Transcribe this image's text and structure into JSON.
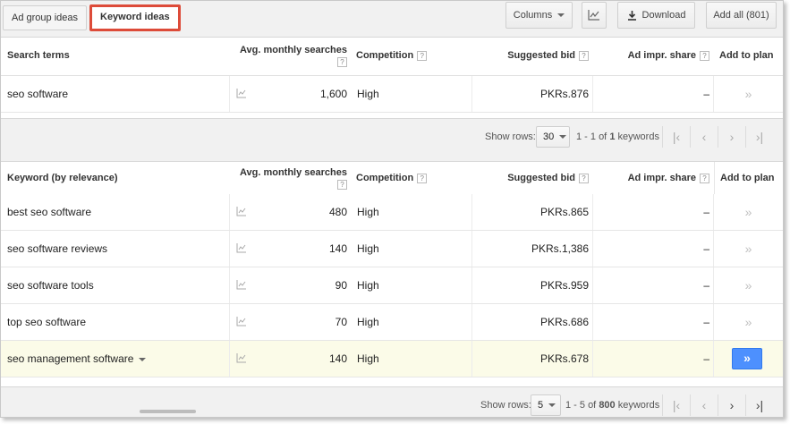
{
  "toolbar": {
    "tab_ad_groups": "Ad group ideas",
    "tab_keywords": "Keyword ideas",
    "columns_label": "Columns",
    "download_label": "Download",
    "add_all_label": "Add all (801)"
  },
  "search_table": {
    "headers": {
      "term": "Search terms",
      "searches": "Avg. monthly searches",
      "competition": "Competition",
      "bid": "Suggested bid",
      "impr": "Ad impr. share",
      "add": "Add to plan"
    },
    "help_mark": "?",
    "rows": [
      {
        "term": "seo software",
        "searches": "1,600",
        "competition": "High",
        "bid": "PKRs.876",
        "impr": "–",
        "add": "»"
      }
    ]
  },
  "search_pager": {
    "show_rows_label": "Show rows:",
    "rows_value": "30",
    "range_text": "1 - 1 of",
    "total": "1",
    "unit": "keywords"
  },
  "keyword_table": {
    "headers": {
      "term": "Keyword (by relevance)",
      "searches": "Avg. monthly searches",
      "competition": "Competition",
      "bid": "Suggested bid",
      "impr": "Ad impr. share",
      "add": "Add to plan"
    },
    "rows": [
      {
        "term": "best seo software",
        "searches": "480",
        "competition": "High",
        "bid": "PKRs.865",
        "impr": "–",
        "add": "»"
      },
      {
        "term": "seo software reviews",
        "searches": "140",
        "competition": "High",
        "bid": "PKRs.1,386",
        "impr": "–",
        "add": "»"
      },
      {
        "term": "seo software tools",
        "searches": "90",
        "competition": "High",
        "bid": "PKRs.959",
        "impr": "–",
        "add": "»"
      },
      {
        "term": "top seo software",
        "searches": "70",
        "competition": "High",
        "bid": "PKRs.686",
        "impr": "–",
        "add": "»"
      },
      {
        "term": "seo management software",
        "searches": "140",
        "competition": "High",
        "bid": "PKRs.678",
        "impr": "–",
        "add": "»"
      }
    ]
  },
  "keyword_pager": {
    "show_rows_label": "Show rows:",
    "rows_value": "5",
    "range_text": "1 - 5 of",
    "total": "800",
    "unit": "keywords"
  },
  "icons": {
    "trend": "line-chart-icon",
    "download": "download-icon",
    "first": "|‹",
    "prev": "‹",
    "next": "›",
    "last": "›|"
  },
  "colors": {
    "active_tab_border": "#dd4b39",
    "add_button": "#4d90fe",
    "highlight_row": "#fbfbe8"
  }
}
